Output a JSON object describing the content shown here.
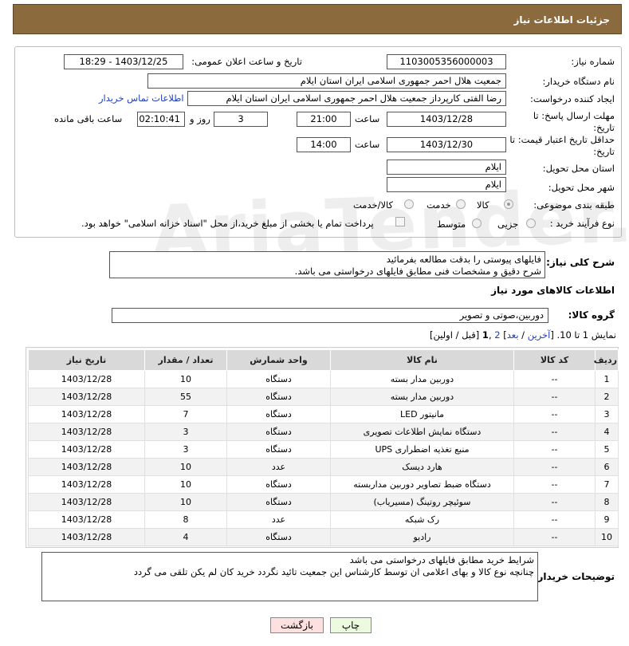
{
  "header": {
    "title": "جزئیات اطلاعات نیاز"
  },
  "watermark": "AriaTender.net",
  "fields": {
    "need_number_label": "شماره نیاز:",
    "need_number": "1103005356000003",
    "announce_label": "تاریخ و ساعت اعلان عمومی:",
    "announce_value": "1403/12/25 - 18:29",
    "buyer_org_label": "نام دستگاه خریدار:",
    "buyer_org": "جمعیت هلال احمر جمهوری اسلامی ایران استان ایلام",
    "creator_label": "ایجاد کننده درخواست:",
    "creator": "رضا الفتی کارپرداز جمعیت هلال احمر جمهوری اسلامی ایران استان ایلام",
    "contact_link": "اطلاعات تماس خریدار",
    "reply_deadline_label": "مهلت ارسال پاسخ: تا تاریخ:",
    "reply_date": "1403/12/28",
    "time_label": "ساعت",
    "reply_time": "21:00",
    "days": "3",
    "days_label": "روز و",
    "remaining_time": "02:10:41",
    "remaining_label": "ساعت باقی مانده",
    "price_validity_label": "حداقل تاریخ اعتبار قیمت: تا تاریخ:",
    "price_date": "1403/12/30",
    "price_time": "14:00",
    "delivery_province_label": "استان محل تحویل:",
    "delivery_province": "ایلام",
    "delivery_city_label": "شهر محل تحویل:",
    "delivery_city": "ایلام",
    "category_label": "طبقه بندی موضوعی:",
    "category_options": [
      "کالا",
      "خدمت",
      "کالا/خدمت"
    ],
    "process_label": "نوع فرآیند خرید :",
    "process_options": [
      "جزیی",
      "متوسط"
    ],
    "payment_note": "پرداخت تمام یا بخشی از مبلغ خرید،از محل \"اسناد خزانه اسلامی\" خواهد بود."
  },
  "description": {
    "label": "شرح کلی نیاز:",
    "line1": "فایلهای پیوستی را بدقت مطالعه بفرمائید",
    "line2": "شرح دقیق و مشخصات فنی مطابق فایلهای درخواستی می باشد."
  },
  "goods_info_title": "اطلاعات کالاهای مورد نیاز",
  "goods_group": {
    "label": "گروه کالا:",
    "value": "دوربین،صوتی و تصویر"
  },
  "pagination": {
    "prefix": "نمایش 1 تا 10. [",
    "last": "آخرین",
    "sep1": " / ",
    "next": "بعد",
    "close1": "] ",
    "page2": "2",
    "comma": " ,",
    "page1": "1",
    "suffix": " [قبل / اولین]"
  },
  "table": {
    "headers": [
      "ردیف",
      "کد کالا",
      "نام کالا",
      "واحد شمارش",
      "تعداد / مقدار",
      "تاریخ نیاز"
    ],
    "rows": [
      [
        "1",
        "--",
        "دوربین مدار بسته",
        "دستگاه",
        "10",
        "1403/12/28"
      ],
      [
        "2",
        "--",
        "دوربین مدار بسته",
        "دستگاه",
        "55",
        "1403/12/28"
      ],
      [
        "3",
        "--",
        "مانیتور LED",
        "دستگاه",
        "7",
        "1403/12/28"
      ],
      [
        "4",
        "--",
        "دستگاه نمایش اطلاعات تصویری",
        "دستگاه",
        "3",
        "1403/12/28"
      ],
      [
        "5",
        "--",
        "منبع تغذیه اضطراری UPS",
        "دستگاه",
        "3",
        "1403/12/28"
      ],
      [
        "6",
        "--",
        "هارد دیسک",
        "عدد",
        "10",
        "1403/12/28"
      ],
      [
        "7",
        "--",
        "دستگاه ضبط تصاویر دوربین مداربسته",
        "دستگاه",
        "10",
        "1403/12/28"
      ],
      [
        "8",
        "--",
        "سوئیچر روتینگ (مسیریاب)",
        "دستگاه",
        "10",
        "1403/12/28"
      ],
      [
        "9",
        "--",
        "رک شبکه",
        "عدد",
        "8",
        "1403/12/28"
      ],
      [
        "10",
        "--",
        "رادیو",
        "دستگاه",
        "4",
        "1403/12/28"
      ]
    ]
  },
  "buyer_notes": {
    "label": "توضیحات خریدار:",
    "line1": "شرایط خرید مطابق فایلهای درخواستی می باشد",
    "line2": "چنانچه نوع کالا و بهای اعلامی ان توسط کارشناس این جمعیت تائید نگردد خرید کان لم یکن تلقی می گردد"
  },
  "buttons": {
    "print": "چاپ",
    "back": "بازگشت"
  }
}
